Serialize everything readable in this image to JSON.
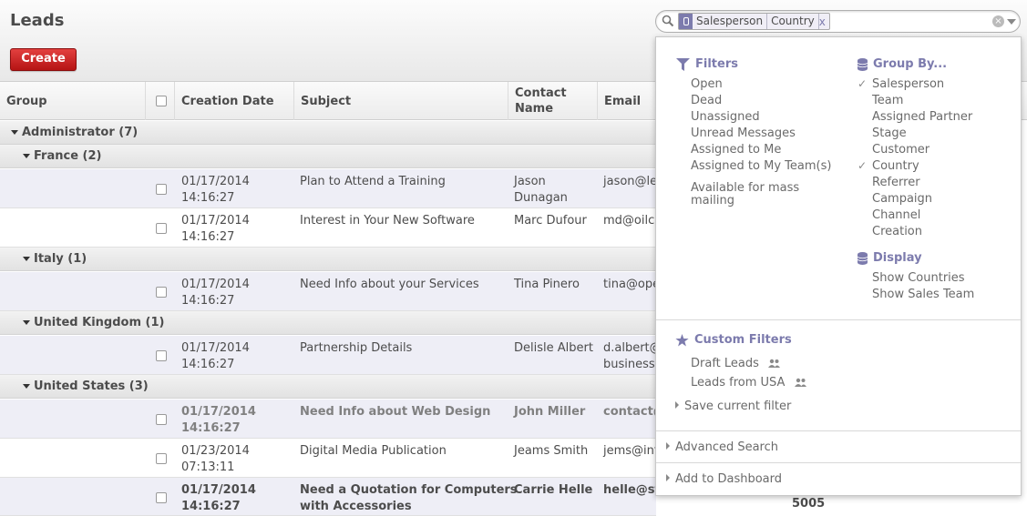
{
  "page": {
    "title": "Leads",
    "create_label": "Create"
  },
  "search": {
    "facet_values": [
      "Salesperson",
      "Country"
    ],
    "facet_remove": "x"
  },
  "table": {
    "headers": {
      "group": "Group",
      "creation_date": "Creation Date",
      "subject": "Subject",
      "contact_line1": "Contact",
      "contact_line2": "Name",
      "email": "Email"
    },
    "groups": [
      {
        "label": "Administrator (7)"
      },
      {
        "label": "France (2)"
      },
      {
        "label": "Italy (1)"
      },
      {
        "label": "United Kingdom (1)"
      },
      {
        "label": "United States (3)"
      }
    ],
    "rows": [
      {
        "date": "01/17/2014",
        "time": "14:16:27",
        "subject": "Plan to Attend a Training",
        "subject2": "",
        "contact1": "Jason",
        "contact2": "Dunagan",
        "email1": "jason@le",
        "email2": ""
      },
      {
        "date": "01/17/2014",
        "time": "14:16:27",
        "subject": "Interest in Your New Software",
        "subject2": "",
        "contact1": "Marc Dufour",
        "contact2": "",
        "email1": "md@oilco",
        "email2": ""
      },
      {
        "date": "01/17/2014",
        "time": "14:16:27",
        "subject": "Need Info about your Services",
        "subject2": "",
        "contact1": "Tina Pinero",
        "contact2": "",
        "email1": "tina@ope",
        "email2": ""
      },
      {
        "date": "01/17/2014",
        "time": "14:16:27",
        "subject": "Partnership Details",
        "subject2": "",
        "contact1": "Delisle Albert",
        "contact2": "",
        "email1": "d.albert@",
        "email2": "business."
      },
      {
        "date": "01/17/2014",
        "time": "14:16:27",
        "subject": "Need Info about Web Design",
        "subject2": "",
        "contact1": "John Miller",
        "contact2": "",
        "email1": "contact@",
        "email2": ""
      },
      {
        "date": "01/23/2014",
        "time": "07:13:11",
        "subject": "Digital Media Publication",
        "subject2": "",
        "contact1": "Jeams Smith",
        "contact2": "",
        "email1": "jems@inf",
        "email2": ""
      },
      {
        "date": "01/17/2014",
        "time": "14:16:27",
        "subject": "Need a Quotation for Computers",
        "subject2": "with Accessories",
        "contact1": "Carrie Helle",
        "contact2": "",
        "email1": "helle@st",
        "email2": ""
      }
    ],
    "trailing_value": "5005"
  },
  "dropdown": {
    "filters_title": "Filters",
    "filters": [
      "Open",
      "Dead",
      "Unassigned",
      "Unread Messages",
      "Assigned to Me",
      "Assigned to My Team(s)",
      "Available for mass",
      "mailing"
    ],
    "groupby_title": "Group By...",
    "groupby": [
      "Salesperson",
      "Team",
      "Assigned Partner",
      "Stage",
      "Customer",
      "Country",
      "Referrer",
      "Campaign",
      "Channel",
      "Creation"
    ],
    "groupby_checked": [
      "Salesperson",
      "Country"
    ],
    "display_title": "Display",
    "display": [
      "Show Countries",
      "Show Sales Team"
    ],
    "custom_title": "Custom Filters",
    "custom": [
      "Draft Leads",
      "Leads from USA"
    ],
    "save_filter": "Save current filter",
    "advanced_search": "Advanced Search",
    "add_dashboard": "Add to Dashboard"
  },
  "colors": {
    "accent": "#7c7bad",
    "create_button": "#c21d1d"
  }
}
